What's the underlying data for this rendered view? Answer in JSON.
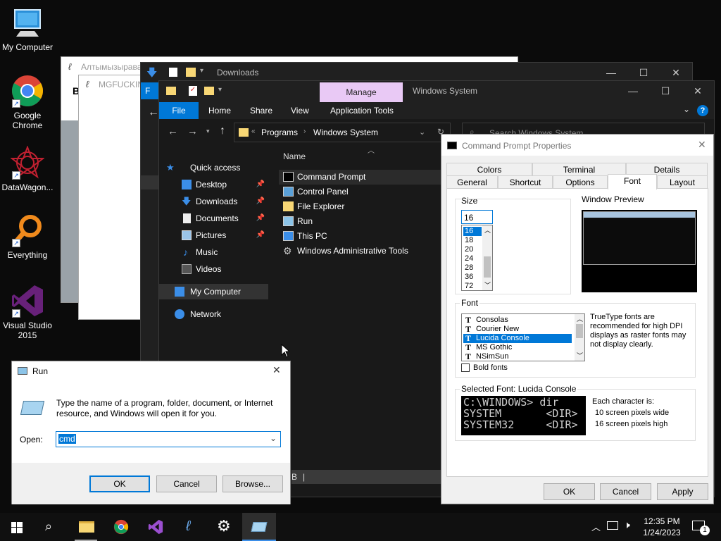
{
  "desktop": {
    "icons": [
      {
        "label": "My Computer"
      },
      {
        "label": "Google Chrome"
      },
      {
        "label": "DataWagon..."
      },
      {
        "label": "Everything"
      },
      {
        "label": "Visual Studio 2015"
      }
    ]
  },
  "bg_window1": {
    "title": "Алтымызырава",
    "letter": "B"
  },
  "bg_window2": {
    "title": "MGFUCKIN"
  },
  "downloads_window": {
    "title": "Downloads",
    "ribbon_file": "F"
  },
  "explorer": {
    "manage_tab": "Manage",
    "title": "Windows System",
    "ribbon_tabs": {
      "file": "File",
      "home": "Home",
      "share": "Share",
      "view": "View",
      "application_tools": "Application Tools"
    },
    "breadcrumb": {
      "sep": "«",
      "part1": "Programs",
      "part2": "Windows System"
    },
    "search_placeholder": "Search Windows System",
    "column_name": "Name",
    "nav": {
      "quick_access": "Quick access",
      "desktop": "Desktop",
      "downloads": "Downloads",
      "documents": "Documents",
      "pictures": "Pictures",
      "music": "Music",
      "videos": "Videos",
      "my_computer": "My Computer",
      "network": "Network"
    },
    "files": [
      {
        "name": "Command Prompt"
      },
      {
        "name": "Control Panel"
      },
      {
        "name": "File Explorer"
      },
      {
        "name": "Run"
      },
      {
        "name": "This PC"
      },
      {
        "name": "Windows Administrative Tools"
      }
    ],
    "status_fragment": "B"
  },
  "run_dialog": {
    "title": "Run",
    "description": "Type the name of a program, folder, document, or Internet resource, and Windows will open it for you.",
    "open_label": "Open:",
    "open_value": "cmd",
    "ok": "OK",
    "cancel": "Cancel",
    "browse": "Browse..."
  },
  "cmd_properties": {
    "title": "Command Prompt Properties",
    "tabs_top": {
      "colors": "Colors",
      "terminal": "Terminal",
      "details": "Details"
    },
    "tabs_bottom": {
      "general": "General",
      "shortcut": "Shortcut",
      "options": "Options",
      "font": "Font",
      "layout": "Layout"
    },
    "size_label": "Size",
    "size_value": "16",
    "sizes": [
      "16",
      "18",
      "20",
      "24",
      "28",
      "36",
      "72"
    ],
    "window_preview_label": "Window Preview",
    "font_label": "Font",
    "fonts": [
      "Consolas",
      "Courier New",
      "Lucida Console",
      "MS Gothic",
      "NSimSun"
    ],
    "font_note": "TrueType fonts are recommended for high DPI displays as raster fonts may not display clearly.",
    "bold_fonts": "Bold fonts",
    "selected_font_label": "Selected Font: Lucida Console",
    "sample_lines": [
      "C:\\WINDOWS> dir",
      "SYSTEM       <DIR>",
      "SYSTEM32     <DIR>"
    ],
    "char_info": {
      "title": "Each character is:",
      "wide": "10 screen pixels wide",
      "high": "16 screen pixels high"
    },
    "ok": "OK",
    "cancel": "Cancel",
    "apply": "Apply"
  },
  "taskbar": {
    "time": "12:35 PM",
    "date": "1/24/2023",
    "notification_count": "1"
  },
  "colors": {
    "accent": "#0078d7",
    "dark_bg": "#191919",
    "taskbar": "#101010"
  }
}
